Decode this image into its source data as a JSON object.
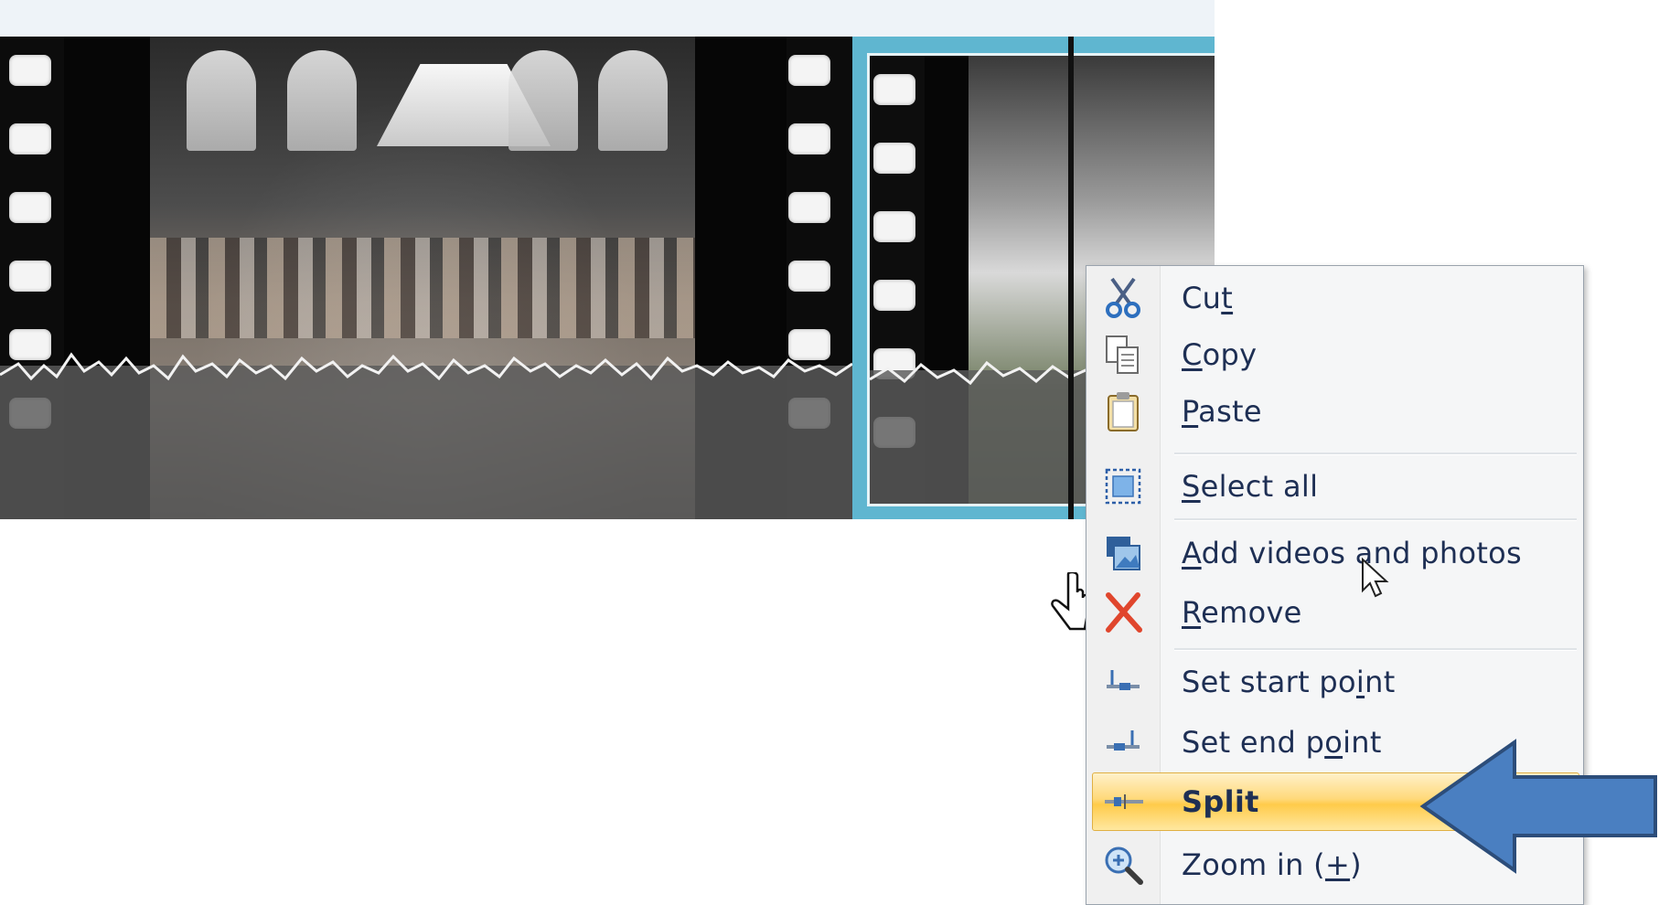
{
  "context_menu": {
    "items": [
      {
        "id": "cut",
        "pre": "Cu",
        "key": "t",
        "post": "",
        "icon": "scissors-icon"
      },
      {
        "id": "copy",
        "pre": "",
        "key": "C",
        "post": "opy",
        "icon": "copy-icon"
      },
      {
        "id": "paste",
        "pre": "",
        "key": "P",
        "post": "aste",
        "icon": "paste-icon"
      },
      {
        "id": "select-all",
        "pre": "",
        "key": "S",
        "post": "elect all",
        "icon": "select-all-icon"
      },
      {
        "id": "add",
        "pre": "",
        "key": "A",
        "post": "dd videos and photos",
        "icon": "add-media-icon"
      },
      {
        "id": "remove",
        "pre": "",
        "key": "R",
        "post": "emove",
        "icon": "remove-x-icon"
      },
      {
        "id": "start",
        "pre": "Set start po",
        "key": "i",
        "post": "nt",
        "icon": "set-start-point-icon"
      },
      {
        "id": "end",
        "pre": "Set end p",
        "key": "o",
        "post": "int",
        "icon": "set-end-point-icon"
      },
      {
        "id": "split",
        "pre": "Sp",
        "key": "",
        "post": "lit",
        "icon": "split-icon"
      },
      {
        "id": "zoom",
        "pre": "Zoom in (",
        "key": "+",
        "post": ")",
        "icon": "zoom-in-icon"
      }
    ],
    "highlighted": "split"
  },
  "colors": {
    "menu_text": "#1e2f54",
    "highlight": "#ffcb4a",
    "arrow_fill": "#4a7fc1",
    "arrow_stroke": "#2c4d7a",
    "selected_clip_border": "#5fb6d0"
  }
}
